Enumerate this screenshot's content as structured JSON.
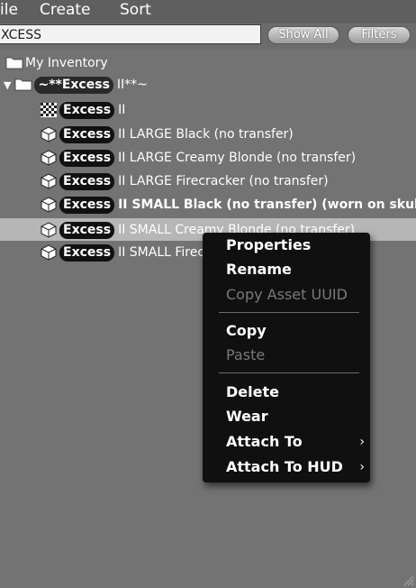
{
  "menubar": {
    "file": "ile",
    "create": "Create",
    "sort": "Sort"
  },
  "search": {
    "value": "XCESS"
  },
  "buttons": {
    "show_all": "Show All",
    "filters": "Filters"
  },
  "tree": {
    "root": "My Inventory",
    "folder": {
      "tag": "~**Excess",
      "rest": "II**~"
    },
    "items": [
      {
        "tag": "Excess",
        "rest": "II"
      },
      {
        "tag": "Excess",
        "rest": "II  LARGE Black (no transfer)"
      },
      {
        "tag": "Excess",
        "rest": "II  LARGE Creamy Blonde (no transfer)"
      },
      {
        "tag": "Excess",
        "rest": "II  LARGE Firecracker (no transfer)"
      },
      {
        "tag": "Excess",
        "rest": "II  SMALL Black (no transfer) (worn on skull)"
      },
      {
        "tag": "Excess",
        "rest": "II  SMALL Creamy Blonde (no transfer)"
      },
      {
        "tag": "Excess",
        "rest": "II  SMALL Firec"
      }
    ]
  },
  "context_menu": {
    "properties": "Properties",
    "rename": "Rename",
    "copy_uuid": "Copy Asset UUID",
    "copy": "Copy",
    "paste": "Paste",
    "delete": "Delete",
    "wear": "Wear",
    "attach_to": "Attach To",
    "attach_hud": "Attach To HUD",
    "submenu_arrow": "›"
  },
  "colors": {
    "selection": "#b6b6b6",
    "menu_bg": "#101010",
    "disabled": "#7a7a7a"
  }
}
